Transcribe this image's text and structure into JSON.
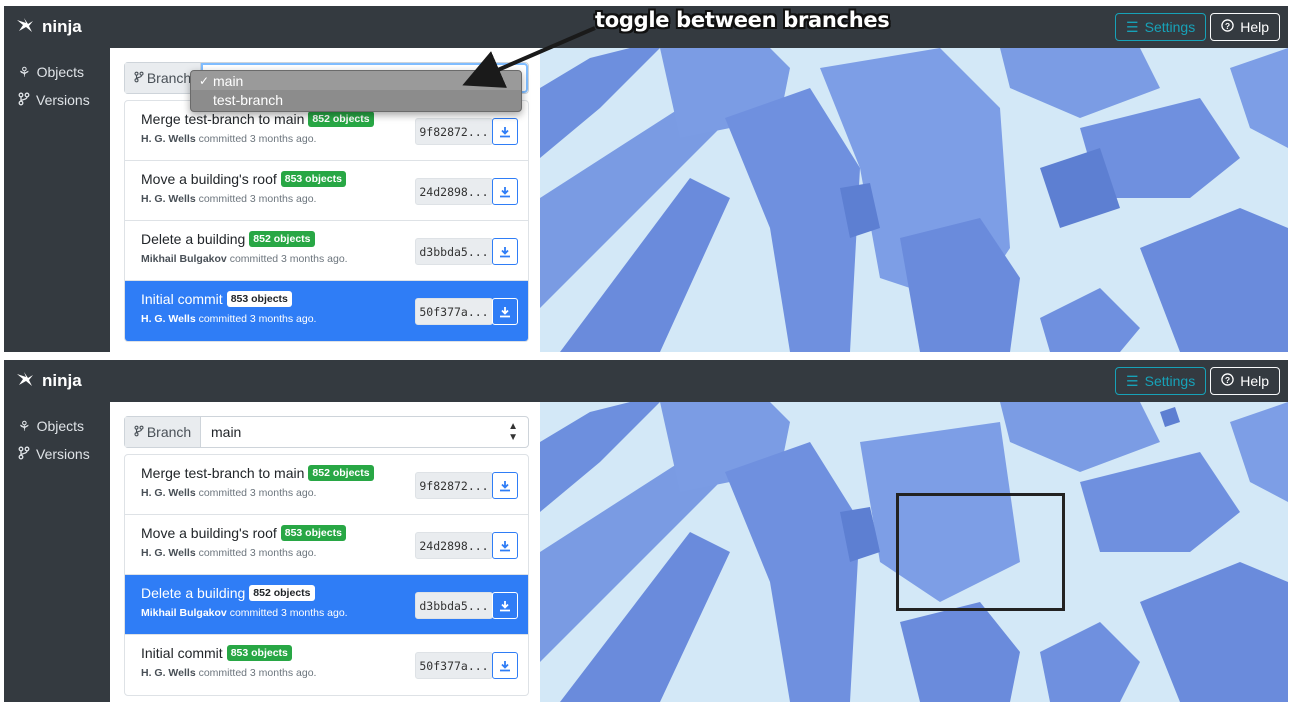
{
  "app": {
    "name": "ninja",
    "logo_icon": "ninja-logo-icon",
    "settings_label": "Settings",
    "help_label": "Help",
    "accent_color": "#17a2b8",
    "active_color": "#2f7df6"
  },
  "sidebar": {
    "items": [
      {
        "label": "Objects",
        "icon": "objects-icon"
      },
      {
        "label": "Versions",
        "icon": "branch-icon"
      }
    ]
  },
  "branch": {
    "label": "Branch",
    "selected": "main",
    "options": [
      "main",
      "test-branch"
    ]
  },
  "commits": [
    {
      "title": "Merge test-branch to main",
      "objects": "852 objects",
      "author": "H. G. Wells",
      "when": "committed 3 months ago.",
      "hash": "9f82872..."
    },
    {
      "title": "Move a building's roof",
      "objects": "853 objects",
      "author": "H. G. Wells",
      "when": "committed 3 months ago.",
      "hash": "24d2898..."
    },
    {
      "title": "Delete a building",
      "objects": "852 objects",
      "author": "Mikhail Bulgakov",
      "when": "committed 3 months ago.",
      "hash": "d3bbda5..."
    },
    {
      "title": "Initial commit",
      "objects": "853 objects",
      "author": "H. G. Wells",
      "when": "committed 3 months ago.",
      "hash": "50f377a..."
    }
  ],
  "annotation": {
    "text": "toggle between branches"
  },
  "panels": {
    "top_selected_commit": "Initial commit",
    "bottom_selected_commit": "Delete a building"
  }
}
